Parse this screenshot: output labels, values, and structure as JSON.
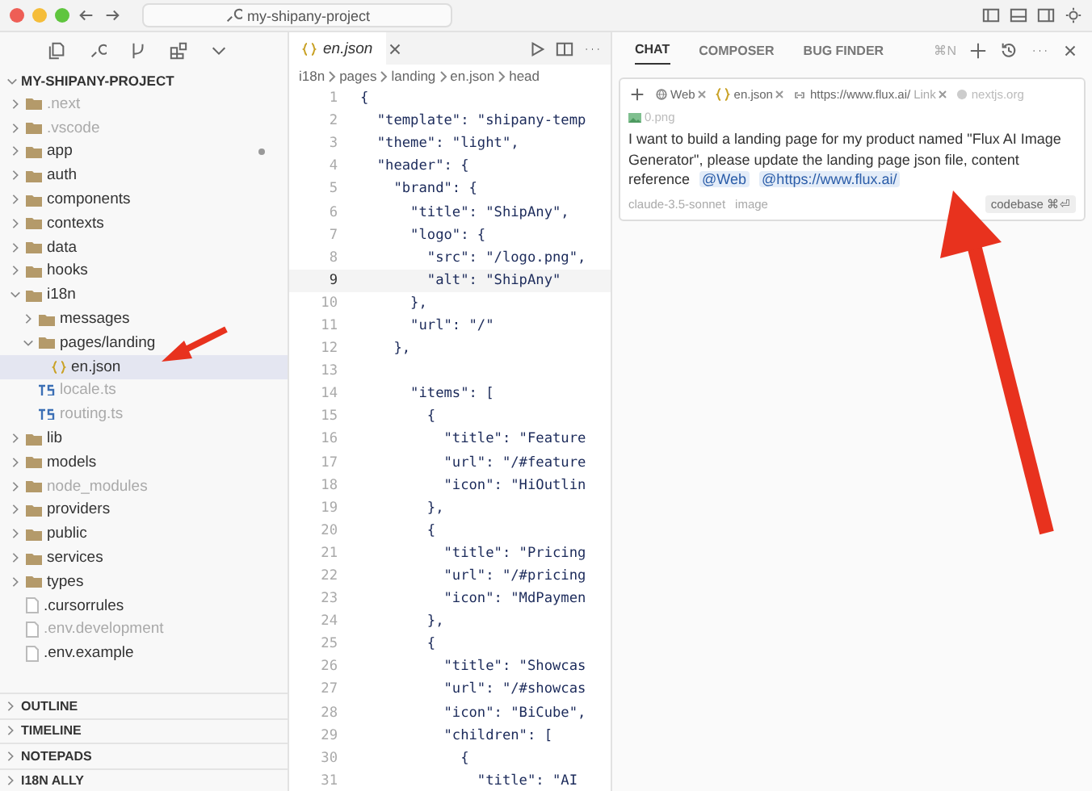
{
  "titlebar": {
    "search": "my-shipany-project"
  },
  "sidebar": {
    "project": "MY-SHIPANY-PROJECT",
    "tree": [
      {
        "name": ".next",
        "kind": "folder",
        "dimmed": true,
        "modified": false,
        "expanded": false
      },
      {
        "name": ".vscode",
        "kind": "folder",
        "dimmed": true,
        "modified": false,
        "expanded": false
      },
      {
        "name": "app",
        "kind": "folder",
        "dimmed": false,
        "modified": true,
        "expanded": false
      },
      {
        "name": "auth",
        "kind": "folder",
        "dimmed": false,
        "modified": false,
        "expanded": false
      },
      {
        "name": "components",
        "kind": "folder",
        "dimmed": false,
        "modified": false,
        "expanded": false
      },
      {
        "name": "contexts",
        "kind": "folder",
        "dimmed": false,
        "modified": false,
        "expanded": false
      },
      {
        "name": "data",
        "kind": "folder",
        "dimmed": false,
        "modified": false,
        "expanded": false
      },
      {
        "name": "hooks",
        "kind": "folder",
        "dimmed": false,
        "modified": false,
        "expanded": false
      },
      {
        "name": "i18n",
        "kind": "folder",
        "dimmed": false,
        "modified": false,
        "expanded": true,
        "children": [
          {
            "name": "messages",
            "kind": "folder",
            "dimmed": false,
            "modified": false,
            "expanded": false
          },
          {
            "name": "pages/landing",
            "kind": "folder",
            "dimmed": false,
            "modified": false,
            "expanded": true,
            "children": [
              {
                "name": "en.json",
                "kind": "json",
                "dimmed": false,
                "modified": false,
                "selected": true
              }
            ]
          },
          {
            "name": "locale.ts",
            "kind": "ts",
            "dimmed": true,
            "modified": false,
            "selected": false
          },
          {
            "name": "routing.ts",
            "kind": "ts",
            "dimmed": true,
            "modified": false,
            "selected": false
          }
        ]
      },
      {
        "name": "lib",
        "kind": "folder",
        "dimmed": false,
        "modified": false,
        "expanded": false
      },
      {
        "name": "models",
        "kind": "folder",
        "dimmed": false,
        "modified": false,
        "expanded": false
      },
      {
        "name": "node_modules",
        "kind": "folder",
        "dimmed": true,
        "modified": false,
        "expanded": false
      },
      {
        "name": "providers",
        "kind": "folder",
        "dimmed": false,
        "modified": false,
        "expanded": false
      },
      {
        "name": "public",
        "kind": "folder",
        "dimmed": false,
        "modified": false,
        "expanded": false
      },
      {
        "name": "services",
        "kind": "folder",
        "dimmed": false,
        "modified": false,
        "expanded": false
      },
      {
        "name": "types",
        "kind": "folder",
        "dimmed": false,
        "modified": false,
        "expanded": false
      },
      {
        "name": ".cursorrules",
        "kind": "file",
        "dimmed": false,
        "modified": false,
        "selected": false
      },
      {
        "name": ".env.development",
        "kind": "file",
        "dimmed": true,
        "modified": false,
        "selected": false
      },
      {
        "name": ".env.example",
        "kind": "file",
        "dimmed": false,
        "modified": false,
        "selected": false
      }
    ],
    "sections": [
      "OUTLINE",
      "TIMELINE",
      "NOTEPADS",
      "I18N ALLY"
    ]
  },
  "editor": {
    "tab": "en.json",
    "breadcrumbs": [
      "i18n",
      "pages",
      "landing",
      "en.json",
      "head"
    ],
    "lines": [
      {
        "n": "1",
        "code": "{",
        "current": false
      },
      {
        "n": "2",
        "code": "  \"template\": \"shipany-temp",
        "current": false
      },
      {
        "n": "3",
        "code": "  \"theme\": \"light\",",
        "current": false
      },
      {
        "n": "4",
        "code": "  \"header\": {",
        "current": false
      },
      {
        "n": "5",
        "code": "    \"brand\": {",
        "current": false
      },
      {
        "n": "6",
        "code": "      \"title\": \"ShipAny\",",
        "current": false
      },
      {
        "n": "7",
        "code": "      \"logo\": {",
        "current": false
      },
      {
        "n": "8",
        "code": "        \"src\": \"/logo.png\",",
        "current": false
      },
      {
        "n": "9",
        "code": "        \"alt\": \"ShipAny\"",
        "current": true
      },
      {
        "n": "10",
        "code": "      },",
        "current": false
      },
      {
        "n": "11",
        "code": "      \"url\": \"/\"",
        "current": false
      },
      {
        "n": "12",
        "code": "    },",
        "current": false
      },
      {
        "n": "13",
        "current": false
      },
      {
        "n": "14",
        "code": "      \"items\": [",
        "current": false
      },
      {
        "n": "15",
        "code": "        {",
        "current": false
      },
      {
        "n": "16",
        "code": "          \"title\": \"Feature",
        "current": false
      },
      {
        "n": "17",
        "code": "          \"url\": \"/#feature",
        "current": false
      },
      {
        "n": "18",
        "code": "          \"icon\": \"HiOutlin",
        "current": false
      },
      {
        "n": "19",
        "code": "        },",
        "current": false
      },
      {
        "n": "20",
        "code": "        {",
        "current": false
      },
      {
        "n": "21",
        "code": "          \"title\": \"Pricing",
        "current": false
      },
      {
        "n": "22",
        "code": "          \"url\": \"/#pricing",
        "current": false
      },
      {
        "n": "23",
        "code": "          \"icon\": \"MdPaymen",
        "current": false
      },
      {
        "n": "24",
        "code": "        },",
        "current": false
      },
      {
        "n": "25",
        "code": "        {",
        "current": false
      },
      {
        "n": "26",
        "code": "          \"title\": \"Showcas",
        "current": false
      },
      {
        "n": "27",
        "code": "          \"url\": \"/#showcas",
        "current": false
      },
      {
        "n": "28",
        "code": "          \"icon\": \"BiCube\",",
        "current": false
      },
      {
        "n": "29",
        "code": "          \"children\": [",
        "current": false
      },
      {
        "n": "30",
        "code": "            {",
        "current": false
      },
      {
        "n": "31",
        "code": "              \"title\": \"AI",
        "current": false
      }
    ]
  },
  "chat": {
    "tabs": [
      {
        "label": "CHAT",
        "selected": true
      },
      {
        "label": "COMPOSER",
        "selected": false
      },
      {
        "label": "BUG FINDER",
        "selected": false
      }
    ],
    "shortcut": "⌘N",
    "chips": [
      {
        "label": "Web",
        "kind": "web"
      },
      {
        "label": "en.json",
        "kind": "file"
      },
      {
        "label": "https://www.flux.ai/",
        "note": "Link",
        "kind": "link"
      },
      {
        "label": "nextjs.org",
        "kind": "faded"
      },
      {
        "label": "0.png",
        "kind": "image"
      }
    ],
    "message": "I want to build a landing page for my product named \"Flux AI Image Generator\", please update the landing page json file, content reference",
    "mentions": [
      "@Web",
      "@https://www.flux.ai/"
    ],
    "model": "claude-3.5-sonnet",
    "image_label": "image",
    "codebase": "codebase ⌘⏎"
  }
}
